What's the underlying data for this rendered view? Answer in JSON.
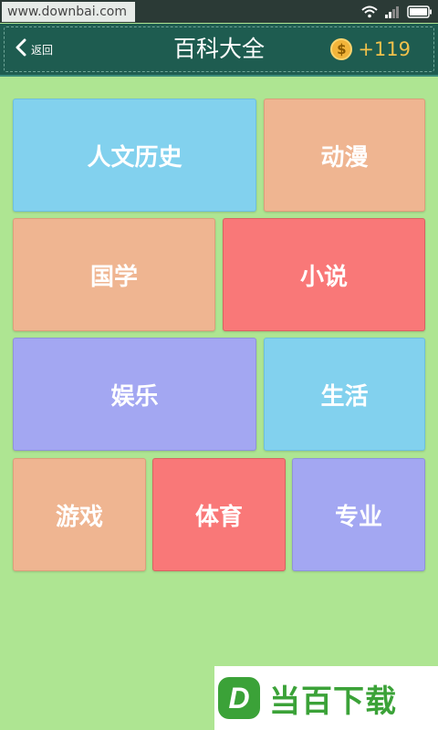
{
  "status_bar": {
    "watermark": "www.downbai.com",
    "icons": [
      "wifi-icon",
      "signal-icon",
      "battery-icon"
    ]
  },
  "header": {
    "back_label": "返回",
    "title": "百科大全",
    "coin_symbol": "$",
    "coin_count": "+119"
  },
  "categories": [
    {
      "label": "人文历史",
      "color": "#82d1ee"
    },
    {
      "label": "动漫",
      "color": "#efb591"
    },
    {
      "label": "国学",
      "color": "#efb591"
    },
    {
      "label": "小说",
      "color": "#f97878"
    },
    {
      "label": "娱乐",
      "color": "#a3a7f2"
    },
    {
      "label": "生活",
      "color": "#82d1ee"
    },
    {
      "label": "游戏",
      "color": "#efb591"
    },
    {
      "label": "体育",
      "color": "#f97878"
    },
    {
      "label": "专业",
      "color": "#a3a7f2"
    }
  ],
  "watermark_bottom": {
    "text": "当百下载",
    "logo_letter": "D"
  },
  "colors": {
    "background": "#aee592",
    "header": "#1e5c50",
    "accent_coin": "#f0c14b"
  }
}
